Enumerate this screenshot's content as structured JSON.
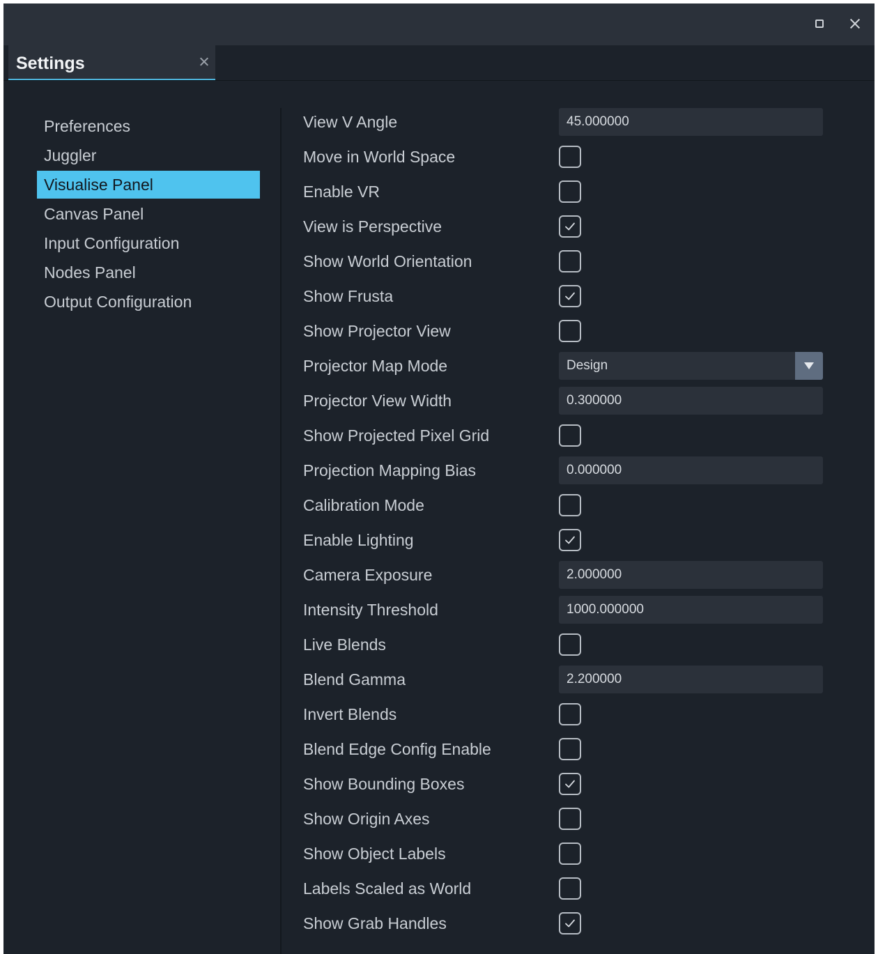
{
  "tab": {
    "title": "Settings"
  },
  "sidebar": {
    "items": [
      {
        "label": "Preferences",
        "active": false
      },
      {
        "label": "Juggler",
        "active": false
      },
      {
        "label": "Visualise Panel",
        "active": true
      },
      {
        "label": "Canvas Panel",
        "active": false
      },
      {
        "label": "Input Configuration",
        "active": false
      },
      {
        "label": "Nodes Panel",
        "active": false
      },
      {
        "label": "Output Configuration",
        "active": false
      }
    ]
  },
  "settings": [
    {
      "label": "View V Angle",
      "type": "text",
      "value": "45.000000"
    },
    {
      "label": "Move in World Space",
      "type": "checkbox",
      "checked": false
    },
    {
      "label": "Enable VR",
      "type": "checkbox",
      "checked": false
    },
    {
      "label": "View is Perspective",
      "type": "checkbox",
      "checked": true
    },
    {
      "label": "Show World Orientation",
      "type": "checkbox",
      "checked": false
    },
    {
      "label": "Show Frusta",
      "type": "checkbox",
      "checked": true
    },
    {
      "label": "Show Projector View",
      "type": "checkbox",
      "checked": false
    },
    {
      "label": "Projector Map Mode",
      "type": "dropdown",
      "value": "Design"
    },
    {
      "label": "Projector View Width",
      "type": "text",
      "value": "0.300000"
    },
    {
      "label": "Show Projected Pixel Grid",
      "type": "checkbox",
      "checked": false
    },
    {
      "label": "Projection Mapping Bias",
      "type": "text",
      "value": "0.000000"
    },
    {
      "label": "Calibration Mode",
      "type": "checkbox",
      "checked": false
    },
    {
      "label": "Enable Lighting",
      "type": "checkbox",
      "checked": true
    },
    {
      "label": "Camera Exposure",
      "type": "text",
      "value": "2.000000"
    },
    {
      "label": "Intensity Threshold",
      "type": "text",
      "value": "1000.000000"
    },
    {
      "label": "Live Blends",
      "type": "checkbox",
      "checked": false
    },
    {
      "label": "Blend Gamma",
      "type": "text",
      "value": "2.200000"
    },
    {
      "label": "Invert Blends",
      "type": "checkbox",
      "checked": false
    },
    {
      "label": "Blend Edge Config Enable",
      "type": "checkbox",
      "checked": false
    },
    {
      "label": "Show Bounding Boxes",
      "type": "checkbox",
      "checked": true
    },
    {
      "label": "Show Origin Axes",
      "type": "checkbox",
      "checked": false
    },
    {
      "label": "Show Object Labels",
      "type": "checkbox",
      "checked": false
    },
    {
      "label": "Labels Scaled as World",
      "type": "checkbox",
      "checked": false
    },
    {
      "label": "Show Grab Handles",
      "type": "checkbox",
      "checked": true
    }
  ],
  "colors": {
    "background": "#1c222a",
    "panel": "#2b313a",
    "accent": "#4fc3ee",
    "text": "#c9ced4"
  }
}
